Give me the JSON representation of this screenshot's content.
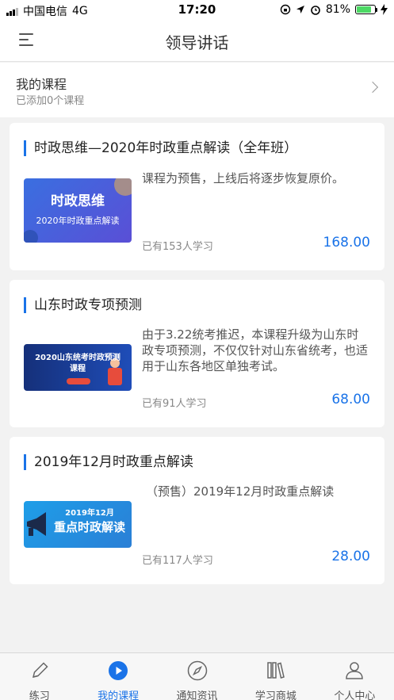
{
  "status_bar": {
    "carrier": "中国电信",
    "network": "4G",
    "time": "17:20",
    "battery": "81%",
    "battery_level": 0.81
  },
  "nav": {
    "title": "领导讲话",
    "menu_icon": "menu-icon"
  },
  "my_course": {
    "title": "我的课程",
    "subtitle": "已添加0个课程"
  },
  "courses": [
    {
      "title": "时政思维—2020年时政重点解读（全年班）",
      "desc": "课程为预售，上线后将逐步恢复原价。",
      "learners": "已有153人学习",
      "price": "168.00",
      "thumb_line1": "时政思维",
      "thumb_line2": "2020年时政重点解读"
    },
    {
      "title": "山东时政专项预测",
      "desc": "由于3.22统考推迟，本课程升级为山东时政专项预测，不仅仅针对山东省统考，也适用于山东各地区单独考试。",
      "learners": "已有91人学习",
      "price": "68.00",
      "thumb_line1": "2020山东统考时政预测",
      "thumb_line2": "课程"
    },
    {
      "title": "2019年12月时政重点解读",
      "desc": "（预售）2019年12月时政重点解读",
      "learners": "已有117人学习",
      "price": "28.00",
      "thumb_line1": "2019年12月",
      "thumb_line2": "重点时政解读"
    }
  ],
  "tabs": [
    {
      "label": "练习",
      "icon": "pencil-icon"
    },
    {
      "label": "我的课程",
      "icon": "play-icon"
    },
    {
      "label": "通知资讯",
      "icon": "compass-icon"
    },
    {
      "label": "学习商城",
      "icon": "books-icon"
    },
    {
      "label": "个人中心",
      "icon": "person-icon"
    }
  ],
  "colors": {
    "accent": "#1a73e8",
    "background": "#f2f2f2"
  }
}
